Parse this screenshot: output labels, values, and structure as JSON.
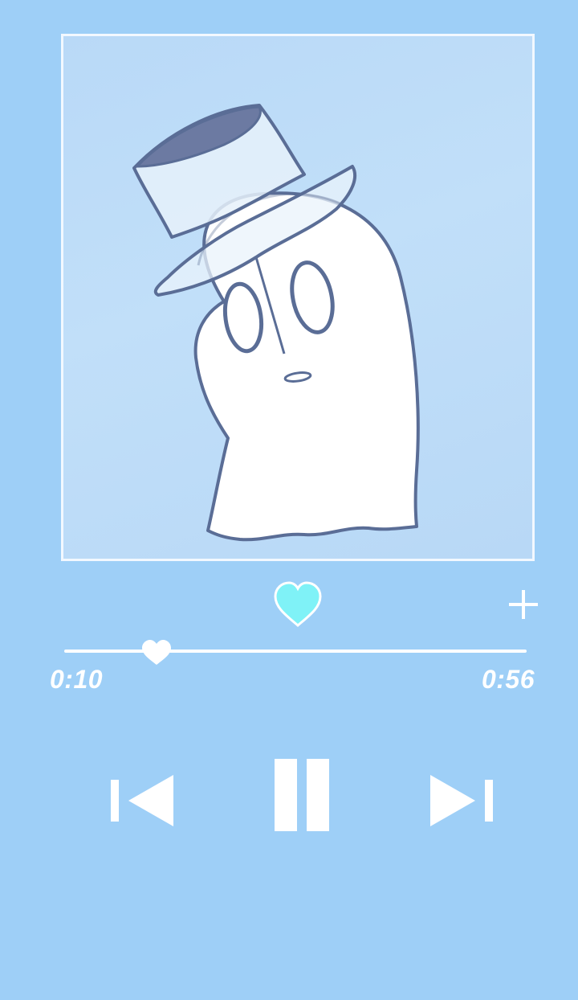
{
  "player": {
    "artwork": {
      "subject": "ghost-with-top-hat",
      "background_color": "#bcdbf8",
      "border_color": "#f2f8ff"
    },
    "like": {
      "icon": "heart-icon",
      "liked": true,
      "color": "#7ff2f7"
    },
    "add": {
      "icon": "plus-icon"
    },
    "progress": {
      "elapsed": "0:10",
      "total": "0:56",
      "fraction": 0.2,
      "thumb_icon": "heart-icon"
    },
    "controls": {
      "previous": "skip-previous-icon",
      "play_pause": "pause-icon",
      "next": "skip-next-icon"
    },
    "colors": {
      "background": "#9ecff7",
      "foreground": "#ffffff",
      "accent": "#7ff2f7",
      "line": "#5a6d96"
    }
  }
}
